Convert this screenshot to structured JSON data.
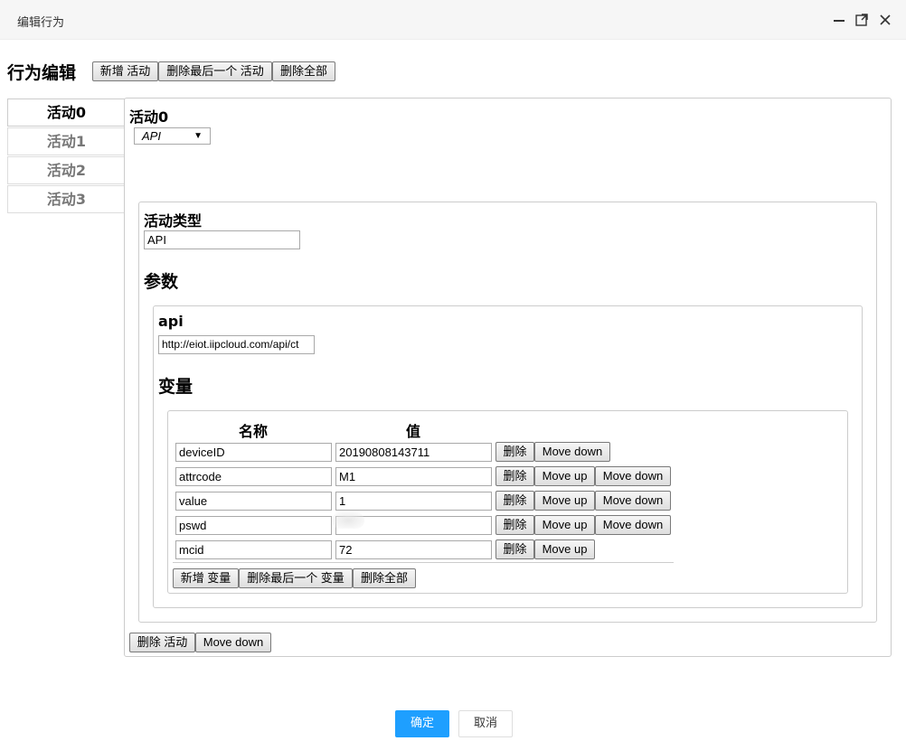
{
  "window": {
    "title": "编辑行为"
  },
  "editor": {
    "heading": "行为编辑",
    "add_activity": "新增 活动",
    "delete_last_activity": "删除最后一个 活动",
    "delete_all": "删除全部"
  },
  "tabs": [
    "活动0",
    "活动1",
    "活动2",
    "活动3"
  ],
  "activity": {
    "title": "活动0",
    "select_value": "API",
    "type_label": "活动类型",
    "type_value": "API",
    "params_heading": "参数",
    "api_label": "api",
    "api_value": "http://eiot.iipcloud.com/api/ct",
    "vars_heading": "变量",
    "col_name": "名称",
    "col_value": "值",
    "variables": [
      {
        "name": "deviceID",
        "value": "20190808143711"
      },
      {
        "name": "attrcode",
        "value": "M1"
      },
      {
        "name": "value",
        "value": "1"
      },
      {
        "name": "pswd",
        "value": ""
      },
      {
        "name": "mcid",
        "value": "72"
      }
    ],
    "row_delete": "删除",
    "move_up": "Move up",
    "move_down": "Move down",
    "add_var": "新增 变量",
    "delete_last_var": "删除最后一个 变量",
    "delete_all_vars": "删除全部",
    "delete_activity": "删除 活动",
    "activity_move_down": "Move down"
  },
  "footer": {
    "ok": "确定",
    "cancel": "取消"
  }
}
